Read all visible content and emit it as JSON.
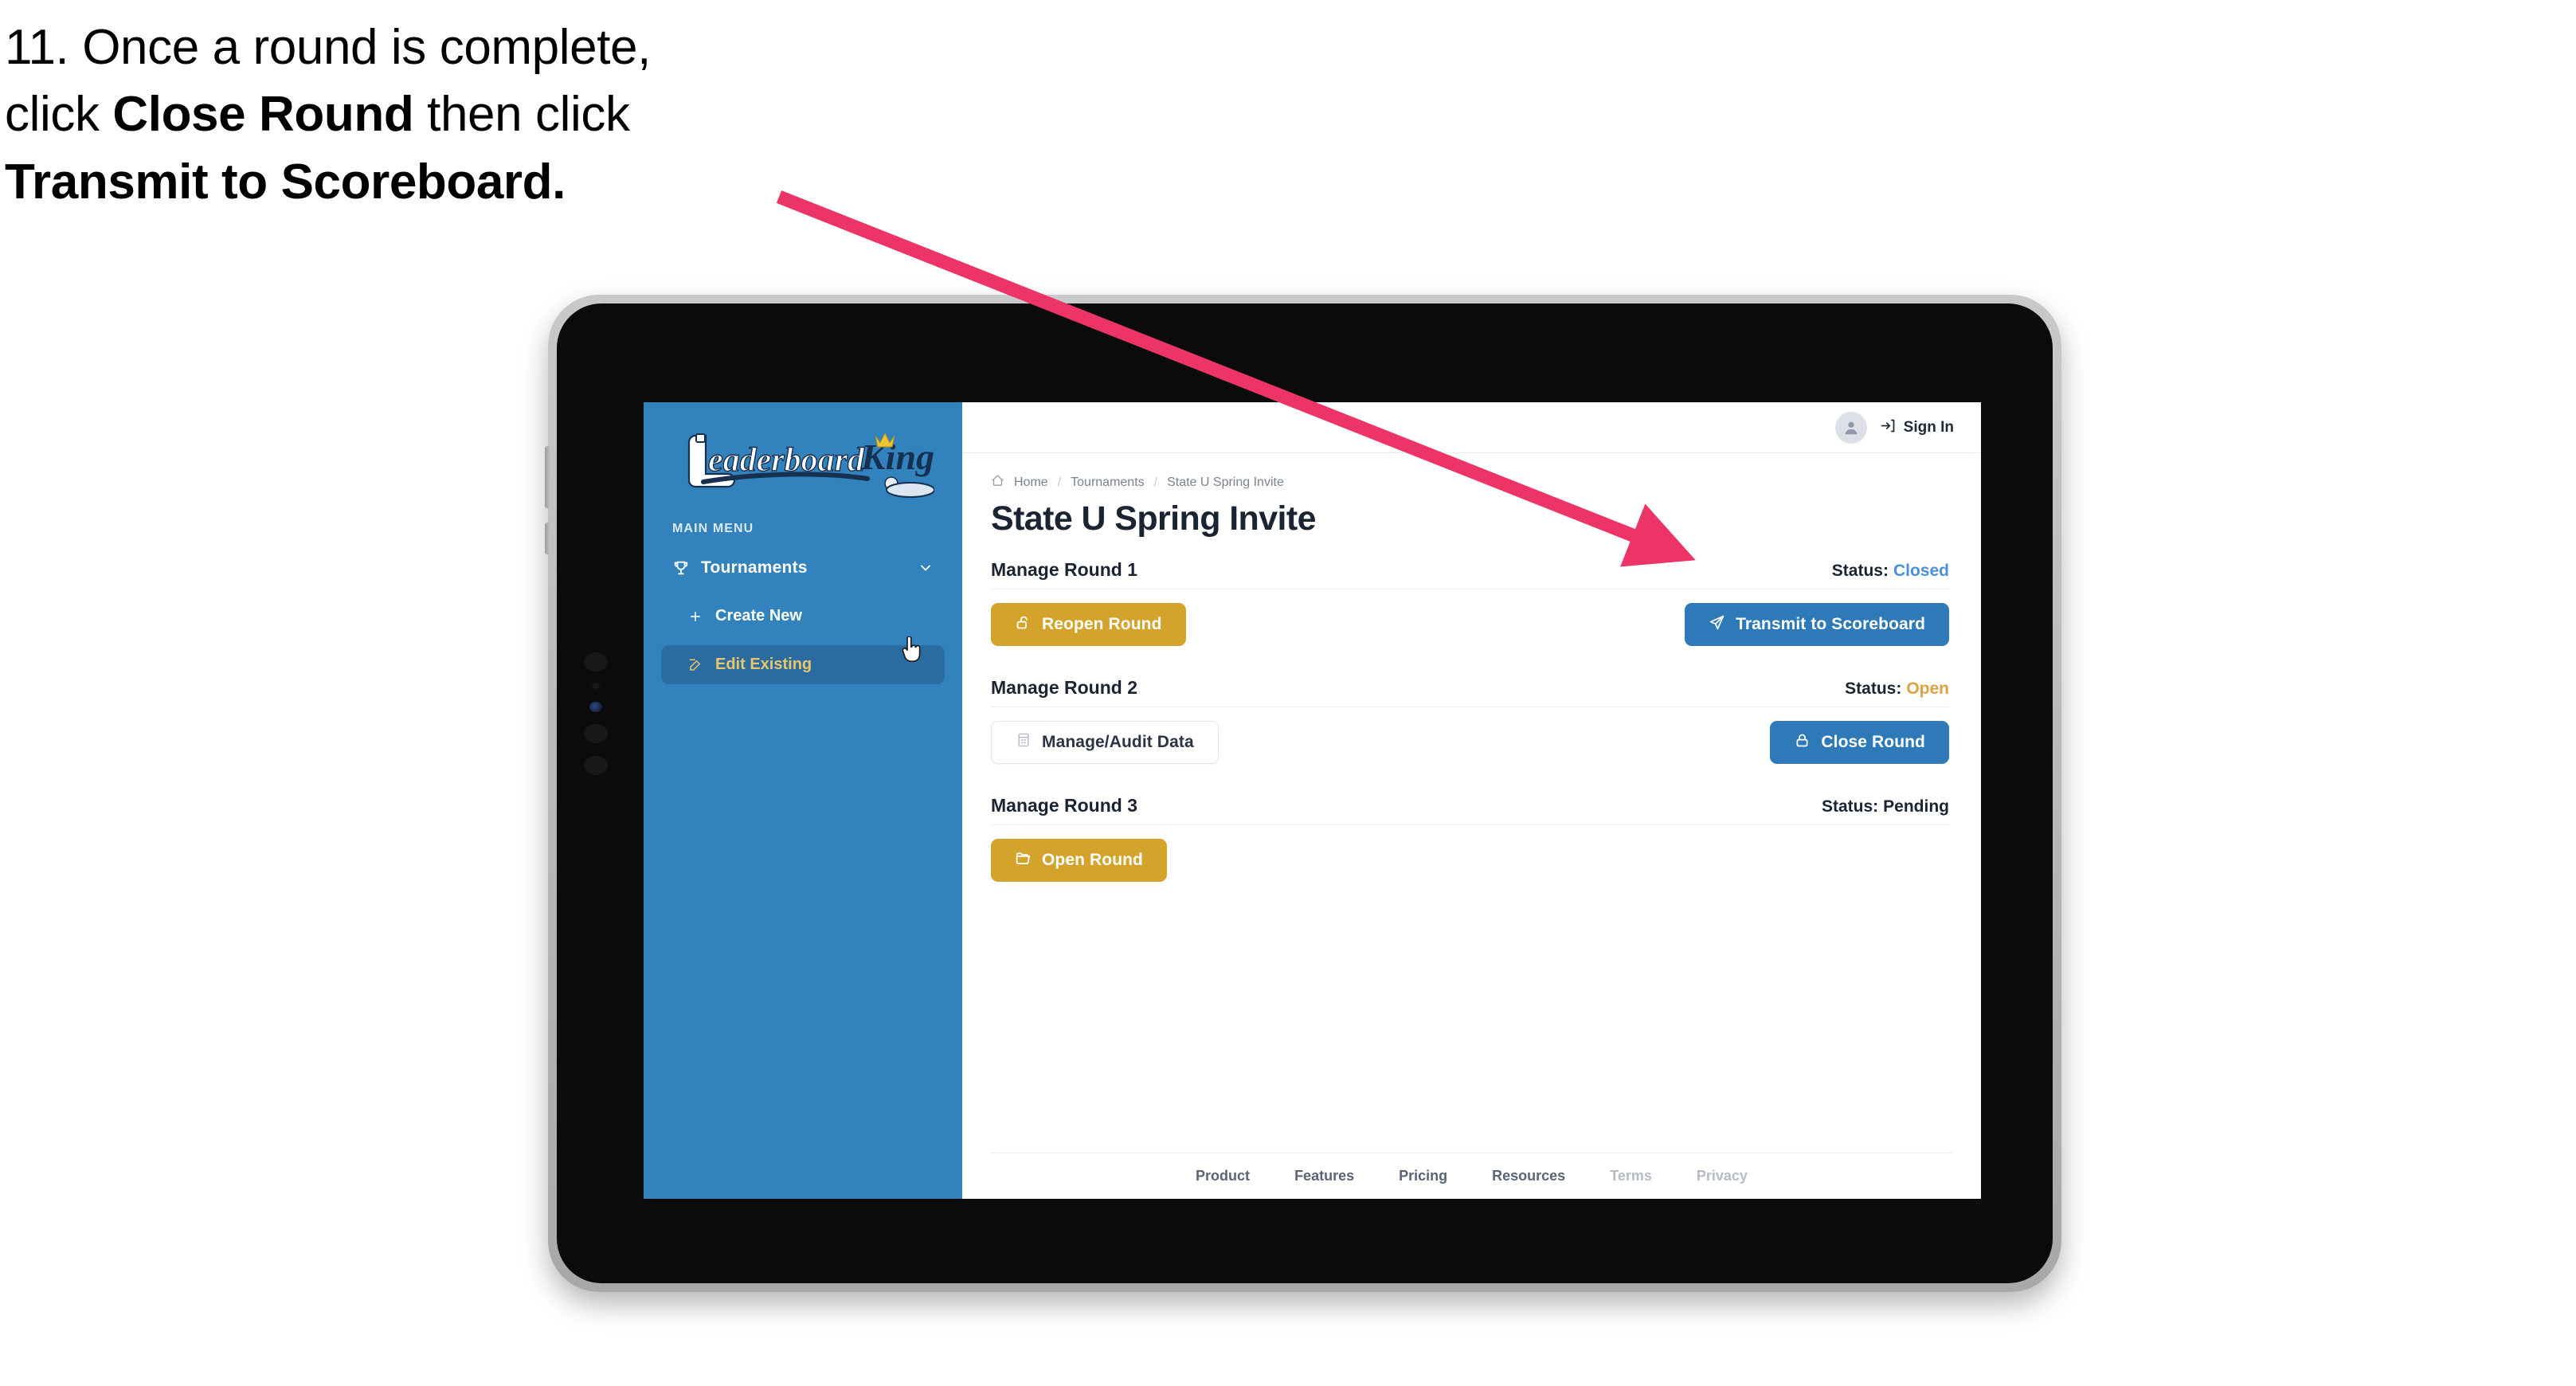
{
  "caption": {
    "line1": "11. Once a round is complete,",
    "line2_pre": "click ",
    "line2_bold": "Close Round",
    "line2_post": " then click",
    "line3_bold": "Transmit to Scoreboard."
  },
  "annotation": {
    "arrow_color": "#ec3467",
    "points_from": "instruction text",
    "points_to": "Transmit to Scoreboard button"
  },
  "app": {
    "sidebar": {
      "logo_primary": "Leaderboard",
      "logo_secondary": "King",
      "menu_label": "MAIN MENU",
      "items": [
        {
          "label": "Tournaments",
          "icon": "trophy-icon",
          "expanded": true,
          "chevron": "chevron-down-icon"
        }
      ],
      "sub_items": [
        {
          "label": "Create New",
          "icon": "plus-icon",
          "active": false
        },
        {
          "label": "Edit Existing",
          "icon": "pencil-square-icon",
          "active": true
        }
      ],
      "bg_color": "#3182bd",
      "active_bg_color": "#2a6ca1",
      "active_text_color": "#e8c56a"
    },
    "topbar": {
      "avatar_icon": "user-avatar-icon",
      "signin_icon": "sign-in-arrow-icon",
      "signin_label": "Sign In"
    },
    "breadcrumb": {
      "home_icon": "home-icon",
      "items": [
        "Home",
        "Tournaments",
        "State U Spring Invite"
      ],
      "separator": "/"
    },
    "page_title": "State U Spring Invite",
    "rounds": [
      {
        "title": "Manage Round 1",
        "status_label": "Status:",
        "status_value": "Closed",
        "status_color": "#4a90d9",
        "left_button": {
          "label": "Reopen Round",
          "icon": "unlock-icon",
          "style": "gold"
        },
        "right_button": {
          "label": "Transmit to Scoreboard",
          "icon": "paper-plane-icon",
          "style": "blue"
        }
      },
      {
        "title": "Manage Round 2",
        "status_label": "Status:",
        "status_value": "Open",
        "status_color": "#d9a441",
        "left_button": {
          "label": "Manage/Audit Data",
          "icon": "table-grid-icon",
          "style": "ghost"
        },
        "right_button": {
          "label": "Close Round",
          "icon": "lock-icon",
          "style": "blue"
        }
      },
      {
        "title": "Manage Round 3",
        "status_label": "Status:",
        "status_value": "Pending",
        "status_color": "#1b2433",
        "left_button": {
          "label": "Open Round",
          "icon": "folder-open-icon",
          "style": "gold"
        },
        "right_button": null
      }
    ],
    "footer": {
      "links": [
        {
          "label": "Product",
          "muted": false
        },
        {
          "label": "Features",
          "muted": false
        },
        {
          "label": "Pricing",
          "muted": false
        },
        {
          "label": "Resources",
          "muted": false
        },
        {
          "label": "Terms",
          "muted": true
        },
        {
          "label": "Privacy",
          "muted": true
        }
      ]
    }
  },
  "colors": {
    "gold": "#d4a32c",
    "blue": "#2e7ab8",
    "sidebar_blue": "#3182bd",
    "arrow_pink": "#ec3467",
    "title_dark": "#1b2433"
  }
}
